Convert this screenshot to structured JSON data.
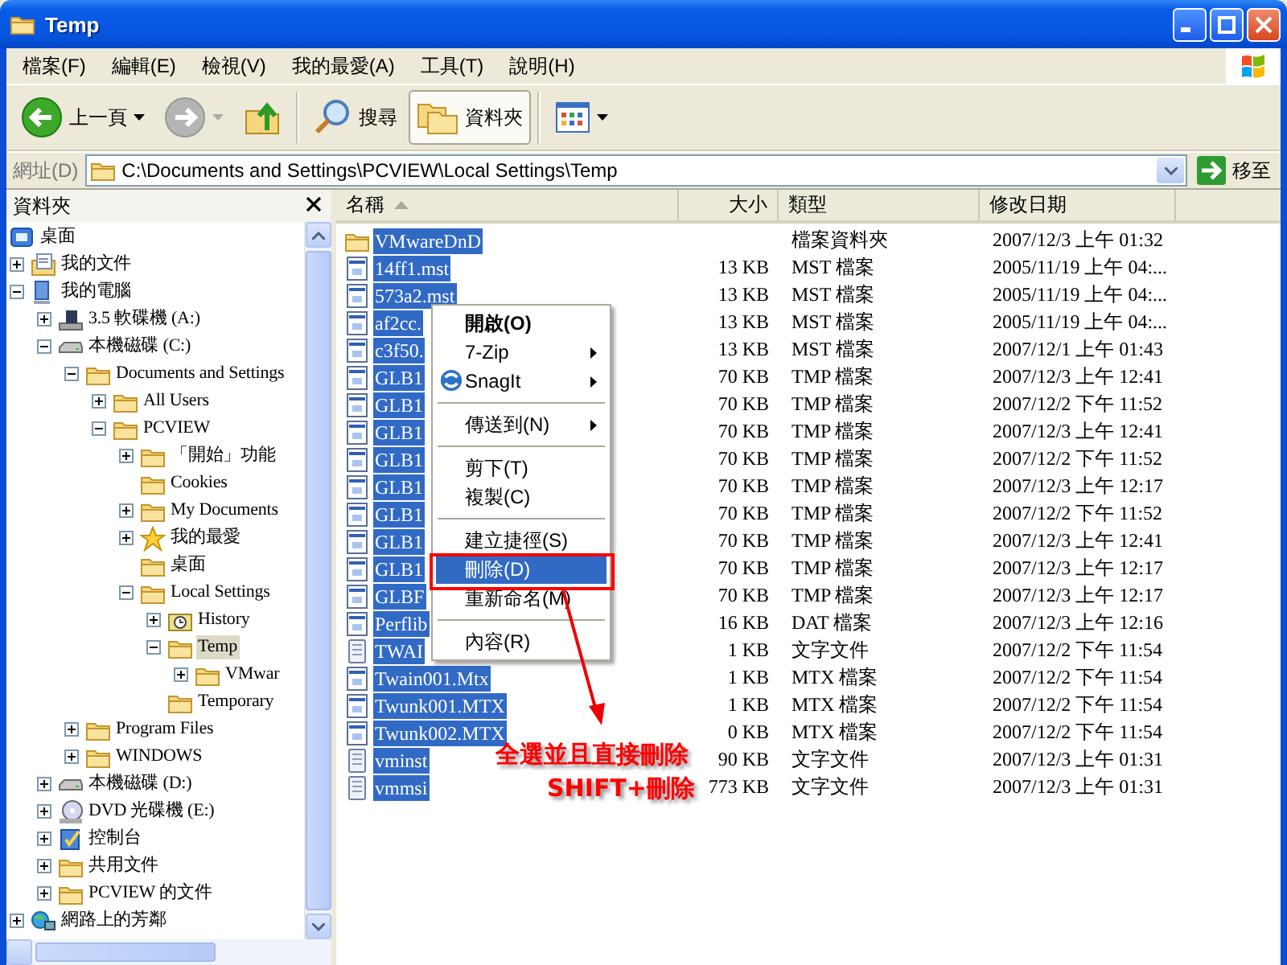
{
  "window": {
    "title": "Temp"
  },
  "menu_bar": [
    "檔案(F)",
    "編輯(E)",
    "檢視(V)",
    "我的最愛(A)",
    "工具(T)",
    "說明(H)"
  ],
  "toolbar": [
    {
      "kind": "back",
      "label": "上一頁",
      "disabled": false,
      "dropdown": true
    },
    {
      "kind": "forward",
      "disabled": true,
      "dropdown": true
    },
    {
      "kind": "up",
      "disabled": false
    },
    {
      "kind": "separator"
    },
    {
      "kind": "search",
      "label": "搜尋",
      "pressed": false
    },
    {
      "kind": "folders",
      "label": "資料夾",
      "pressed": true
    },
    {
      "kind": "separator"
    },
    {
      "kind": "views",
      "dropdown": true
    }
  ],
  "address_bar": {
    "label": "網址(D)",
    "value": "C:\\Documents and Settings\\PCVIEW\\Local Settings\\Temp",
    "go_label": "移至"
  },
  "folders_pane": {
    "title": "資料夾",
    "tree": [
      {
        "label": "桌面",
        "kind": "desktop",
        "selected": false,
        "children": [
          {
            "label": "我的文件",
            "kind": "docs",
            "expanded": false,
            "selected": false
          },
          {
            "label": "我的電腦",
            "kind": "computer",
            "expanded": true,
            "selected": false,
            "children": [
              {
                "label": "3.5 軟碟機 (A:)",
                "kind": "floppy",
                "expanded": false,
                "selected": false
              },
              {
                "label": "本機磁碟 (C:)",
                "kind": "drive",
                "expanded": true,
                "selected": false,
                "children": [
                  {
                    "label": "Documents and Settings",
                    "kind": "folder",
                    "expanded": true,
                    "selected": false,
                    "children": [
                      {
                        "label": "All Users",
                        "kind": "folder",
                        "expanded": false,
                        "selected": false
                      },
                      {
                        "label": "PCVIEW",
                        "kind": "folder",
                        "expanded": true,
                        "selected": false,
                        "children": [
                          {
                            "label": "「開始」功能",
                            "kind": "folder",
                            "expanded": false,
                            "selected": false
                          },
                          {
                            "label": "Cookies",
                            "kind": "folder",
                            "selected": false
                          },
                          {
                            "label": "My Documents",
                            "kind": "folder",
                            "expanded": false,
                            "selected": false
                          },
                          {
                            "label": "我的最愛",
                            "kind": "star",
                            "expanded": false,
                            "selected": false
                          },
                          {
                            "label": "桌面",
                            "kind": "folder",
                            "selected": false
                          },
                          {
                            "label": "Local Settings",
                            "kind": "folder",
                            "expanded": true,
                            "selected": false,
                            "children": [
                              {
                                "label": "History",
                                "kind": "history",
                                "expanded": false,
                                "selected": false
                              },
                              {
                                "label": "Temp",
                                "kind": "folder",
                                "expanded": true,
                                "selected": true,
                                "children": [
                                  {
                                    "label": "VMwar",
                                    "kind": "folder",
                                    "expanded": false,
                                    "selected": false
                                  }
                                ]
                              },
                              {
                                "label": "Temporary",
                                "kind": "folder",
                                "selected": false
                              }
                            ]
                          }
                        ]
                      }
                    ]
                  },
                  {
                    "label": "Program Files",
                    "kind": "folder",
                    "expanded": false,
                    "selected": false
                  },
                  {
                    "label": "WINDOWS",
                    "kind": "folder",
                    "expanded": false,
                    "selected": false
                  }
                ]
              },
              {
                "label": "本機磁碟 (D:)",
                "kind": "drive",
                "expanded": false,
                "selected": false
              },
              {
                "label": "DVD 光碟機 (E:)",
                "kind": "dvd",
                "expanded": false,
                "selected": false
              },
              {
                "label": "控制台",
                "kind": "control",
                "expanded": false,
                "selected": false
              },
              {
                "label": "共用文件",
                "kind": "folder",
                "expanded": false,
                "selected": false
              },
              {
                "label": "PCVIEW 的文件",
                "kind": "folder",
                "expanded": false,
                "selected": false
              }
            ]
          },
          {
            "label": "網路上的芳鄰",
            "kind": "network",
            "expanded": false,
            "selected": false
          }
        ]
      }
    ]
  },
  "file_list": {
    "columns": [
      {
        "label": "名稱",
        "sorted": true
      },
      {
        "label": "大小",
        "sorted": false
      },
      {
        "label": "類型",
        "sorted": false
      },
      {
        "label": "修改日期",
        "sorted": false
      }
    ],
    "rows": [
      {
        "kind": "folder",
        "name": "VMwareDnD",
        "type": "檔案資料夾",
        "modified": "2007/12/3 上午 01:32",
        "selected": true
      },
      {
        "kind": "file",
        "name": "14ff1.mst",
        "size": "13 KB",
        "type": "MST 檔案",
        "modified": "2005/11/19 上午 04:...",
        "selected": true
      },
      {
        "kind": "file",
        "name": "573a2.mst",
        "size": "13 KB",
        "type": "MST 檔案",
        "modified": "2005/11/19 上午 04:...",
        "selected": true
      },
      {
        "kind": "file",
        "name": "af2cc.",
        "size": "13 KB",
        "type": "MST 檔案",
        "modified": "2005/11/19 上午 04:...",
        "selected": true
      },
      {
        "kind": "file",
        "name": "c3f50.",
        "size": "13 KB",
        "type": "MST 檔案",
        "modified": "2007/12/1 上午 01:43",
        "selected": true
      },
      {
        "kind": "file",
        "name": "GLB1",
        "size": "70 KB",
        "type": "TMP 檔案",
        "modified": "2007/12/3 上午 12:41",
        "selected": true
      },
      {
        "kind": "file",
        "name": "GLB1",
        "size": "70 KB",
        "type": "TMP 檔案",
        "modified": "2007/12/2 下午 11:52",
        "selected": true
      },
      {
        "kind": "file",
        "name": "GLB1",
        "size": "70 KB",
        "type": "TMP 檔案",
        "modified": "2007/12/3 上午 12:41",
        "selected": true
      },
      {
        "kind": "file",
        "name": "GLB1",
        "size": "70 KB",
        "type": "TMP 檔案",
        "modified": "2007/12/2 下午 11:52",
        "selected": true
      },
      {
        "kind": "file",
        "name": "GLB1",
        "size": "70 KB",
        "type": "TMP 檔案",
        "modified": "2007/12/3 上午 12:17",
        "selected": true
      },
      {
        "kind": "file",
        "name": "GLB1",
        "size": "70 KB",
        "type": "TMP 檔案",
        "modified": "2007/12/2 下午 11:52",
        "selected": true
      },
      {
        "kind": "file",
        "name": "GLB1",
        "size": "70 KB",
        "type": "TMP 檔案",
        "modified": "2007/12/3 上午 12:41",
        "selected": true
      },
      {
        "kind": "file",
        "name": "GLB1",
        "size": "70 KB",
        "type": "TMP 檔案",
        "modified": "2007/12/3 上午 12:17",
        "selected": true
      },
      {
        "kind": "file",
        "name": "GLBF",
        "size": "70 KB",
        "type": "TMP 檔案",
        "modified": "2007/12/3 上午 12:17",
        "selected": true
      },
      {
        "kind": "file",
        "name": "Perflib",
        "size": "16 KB",
        "type": "DAT 檔案",
        "modified": "2007/12/3 上午 12:16",
        "selected": true
      },
      {
        "kind": "text",
        "name": "TWAI",
        "size": "1 KB",
        "type": "文字文件",
        "modified": "2007/12/2 下午 11:54",
        "selected": true
      },
      {
        "kind": "file",
        "name": "Twain001.Mtx",
        "size": "1 KB",
        "type": "MTX 檔案",
        "modified": "2007/12/2 下午 11:54",
        "selected": true
      },
      {
        "kind": "file",
        "name": "Twunk001.MTX",
        "size": "1 KB",
        "type": "MTX 檔案",
        "modified": "2007/12/2 下午 11:54",
        "selected": true
      },
      {
        "kind": "file",
        "name": "Twunk002.MTX",
        "size": "0 KB",
        "type": "MTX 檔案",
        "modified": "2007/12/2 下午 11:54",
        "selected": true
      },
      {
        "kind": "text",
        "name": "vminst",
        "size": "90 KB",
        "type": "文字文件",
        "modified": "2007/12/3 上午 01:31",
        "selected": true
      },
      {
        "kind": "text",
        "name": "vmmsi",
        "size": "773 KB",
        "type": "文字文件",
        "modified": "2007/12/3 上午 01:31",
        "selected": true
      }
    ]
  },
  "context_menu": {
    "items": [
      {
        "kind": "item",
        "label": "開啟(O)",
        "default": true,
        "submenu": false,
        "selected": false
      },
      {
        "kind": "item",
        "label": "7-Zip",
        "default": false,
        "submenu": true,
        "selected": false
      },
      {
        "kind": "app",
        "label": "SnagIt",
        "default": false,
        "submenu": true,
        "selected": false
      },
      {
        "kind": "separator"
      },
      {
        "kind": "item",
        "label": "傳送到(N)",
        "default": false,
        "submenu": true,
        "selected": false
      },
      {
        "kind": "separator"
      },
      {
        "kind": "item",
        "label": "剪下(T)",
        "default": false,
        "submenu": false,
        "selected": false
      },
      {
        "kind": "item",
        "label": "複製(C)",
        "default": false,
        "submenu": false,
        "selected": false
      },
      {
        "kind": "separator"
      },
      {
        "kind": "item",
        "label": "建立捷徑(S)",
        "default": false,
        "submenu": false,
        "selected": false
      },
      {
        "kind": "item",
        "label": "刪除(D)",
        "default": false,
        "submenu": false,
        "selected": true
      },
      {
        "kind": "item",
        "label": "重新命名(M)",
        "default": false,
        "submenu": false,
        "selected": false
      },
      {
        "kind": "separator"
      },
      {
        "kind": "item",
        "label": "內容(R)",
        "default": false,
        "submenu": false,
        "selected": false
      }
    ]
  },
  "annotation": {
    "lines": [
      "全選並且直接刪除",
      "SHIFT+刪除"
    ]
  }
}
